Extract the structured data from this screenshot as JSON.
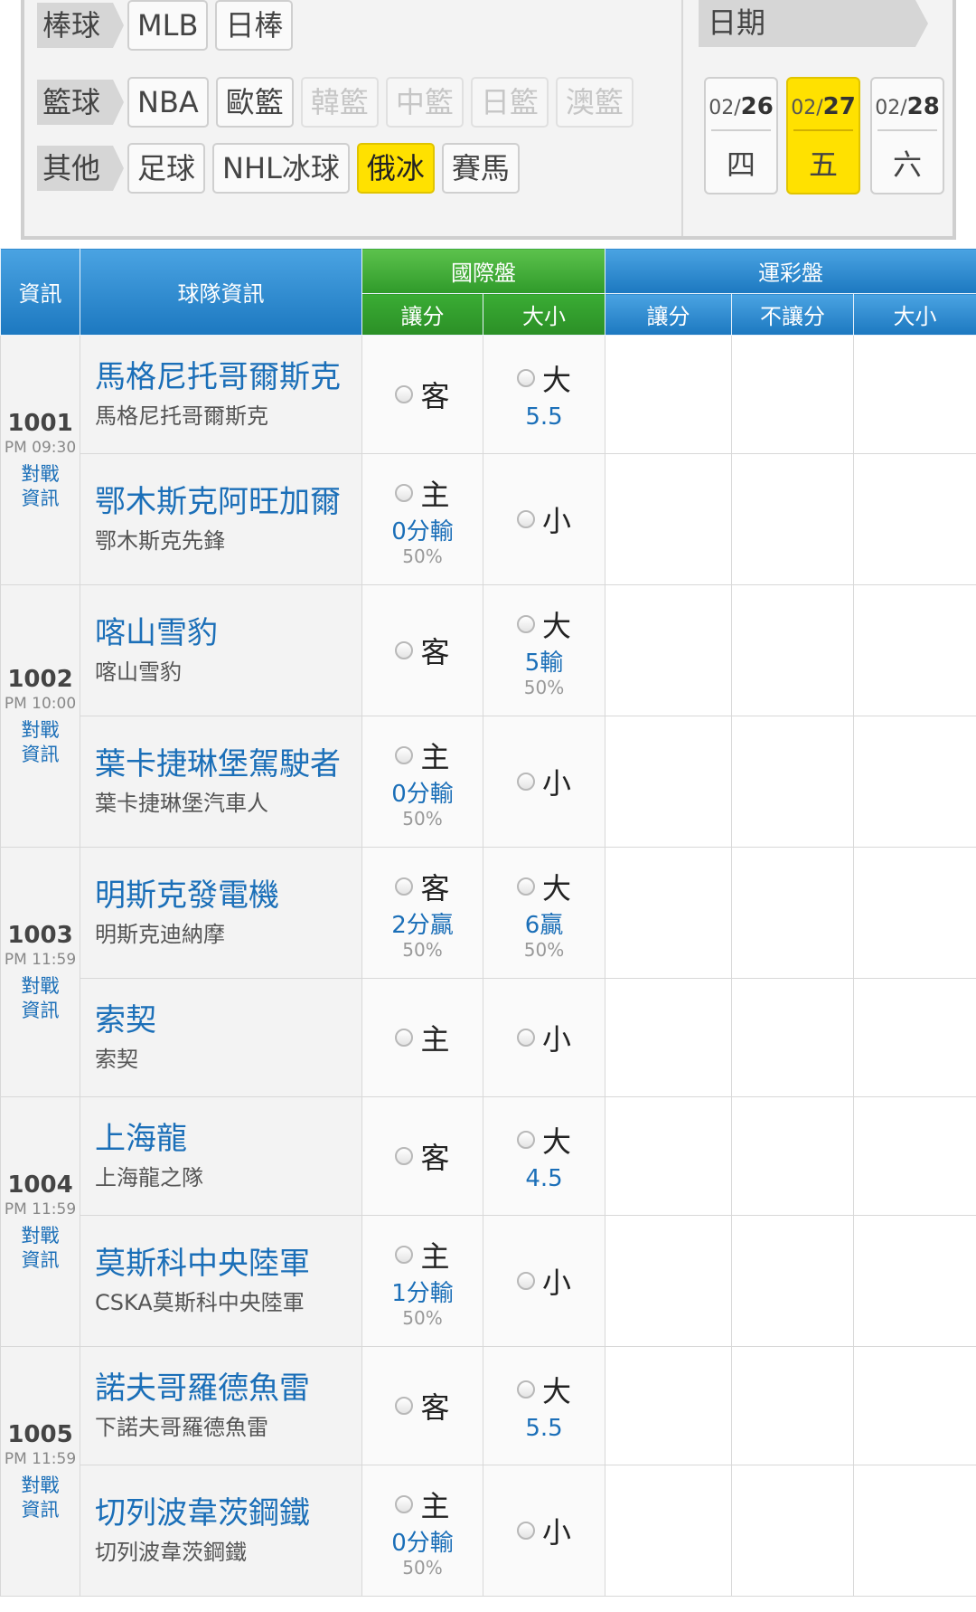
{
  "filters": {
    "rows": [
      {
        "category": "棒球",
        "chips": [
          {
            "label": "MLB",
            "state": "normal"
          },
          {
            "label": "日棒",
            "state": "normal"
          }
        ]
      },
      {
        "category": "籃球",
        "chips": [
          {
            "label": "NBA",
            "state": "normal"
          },
          {
            "label": "歐籃",
            "state": "normal"
          },
          {
            "label": "韓籃",
            "state": "disabled"
          },
          {
            "label": "中籃",
            "state": "disabled"
          },
          {
            "label": "日籃",
            "state": "disabled"
          },
          {
            "label": "澳籃",
            "state": "disabled"
          }
        ]
      },
      {
        "category": "其他",
        "chips": [
          {
            "label": "足球",
            "state": "normal"
          },
          {
            "label": "NHL冰球",
            "state": "normal"
          },
          {
            "label": "俄冰",
            "state": "active"
          },
          {
            "label": "賽馬",
            "state": "normal"
          }
        ]
      }
    ],
    "date_label": "日期",
    "dates": [
      {
        "month": "02/",
        "day": "26",
        "dow": "四",
        "active": false
      },
      {
        "month": "02/",
        "day": "27",
        "dow": "五",
        "active": true
      },
      {
        "month": "02/",
        "day": "28",
        "dow": "六",
        "active": false
      }
    ]
  },
  "table": {
    "headers": {
      "info": "資訊",
      "team": "球隊資訊",
      "intl": "國際盤",
      "intl_spread": "讓分",
      "intl_total": "大小",
      "lottery": "運彩盤",
      "lot_spread": "讓分",
      "lot_nospread": "不讓分",
      "lot_total": "大小"
    },
    "matchup_label": "對戰資訊",
    "games": [
      {
        "no": "1001",
        "time": "PM 09:30",
        "away": {
          "name": "馬格尼托哥爾斯克",
          "sub": "馬格尼托哥爾斯克",
          "spread_side": "客",
          "spread_line": "",
          "spread_pct": "",
          "total_side": "大",
          "total_line": "5.5",
          "total_pct": ""
        },
        "home": {
          "name": "鄂木斯克阿旺加爾",
          "sub": "鄂木斯克先鋒",
          "spread_side": "主",
          "spread_line": "0分輸",
          "spread_pct": "50%",
          "total_side": "小",
          "total_line": "",
          "total_pct": ""
        }
      },
      {
        "no": "1002",
        "time": "PM 10:00",
        "away": {
          "name": "喀山雪豹",
          "sub": "喀山雪豹",
          "spread_side": "客",
          "spread_line": "",
          "spread_pct": "",
          "total_side": "大",
          "total_line": "5輸",
          "total_pct": "50%"
        },
        "home": {
          "name": "葉卡捷琳堡駕駛者",
          "sub": "葉卡捷琳堡汽車人",
          "spread_side": "主",
          "spread_line": "0分輸",
          "spread_pct": "50%",
          "total_side": "小",
          "total_line": "",
          "total_pct": ""
        }
      },
      {
        "no": "1003",
        "time": "PM 11:59",
        "away": {
          "name": "明斯克發電機",
          "sub": "明斯克迪納摩",
          "spread_side": "客",
          "spread_line": "2分贏",
          "spread_pct": "50%",
          "total_side": "大",
          "total_line": "6贏",
          "total_pct": "50%"
        },
        "home": {
          "name": "索契",
          "sub": "索契",
          "spread_side": "主",
          "spread_line": "",
          "spread_pct": "",
          "total_side": "小",
          "total_line": "",
          "total_pct": ""
        }
      },
      {
        "no": "1004",
        "time": "PM 11:59",
        "away": {
          "name": "上海龍",
          "sub": "上海龍之隊",
          "spread_side": "客",
          "spread_line": "",
          "spread_pct": "",
          "total_side": "大",
          "total_line": "4.5",
          "total_pct": ""
        },
        "home": {
          "name": "莫斯科中央陸軍",
          "sub": "CSKA莫斯科中央陸軍",
          "spread_side": "主",
          "spread_line": "1分輸",
          "spread_pct": "50%",
          "total_side": "小",
          "total_line": "",
          "total_pct": ""
        }
      },
      {
        "no": "1005",
        "time": "PM 11:59",
        "away": {
          "name": "諾夫哥羅德魚雷",
          "sub": "下諾夫哥羅德魚雷",
          "spread_side": "客",
          "spread_line": "",
          "spread_pct": "",
          "total_side": "大",
          "total_line": "5.5",
          "total_pct": ""
        },
        "home": {
          "name": "切列波韋茨鋼鐵",
          "sub": "切列波韋茨鋼鐵",
          "spread_side": "主",
          "spread_line": "0分輸",
          "spread_pct": "50%",
          "total_side": "小",
          "total_line": "",
          "total_pct": ""
        }
      }
    ]
  },
  "colors": {
    "accent_yellow": "#ffe100",
    "header_blue": "#1c78c0",
    "header_green": "#2f9a2a",
    "link_blue": "#1b6fb8"
  }
}
